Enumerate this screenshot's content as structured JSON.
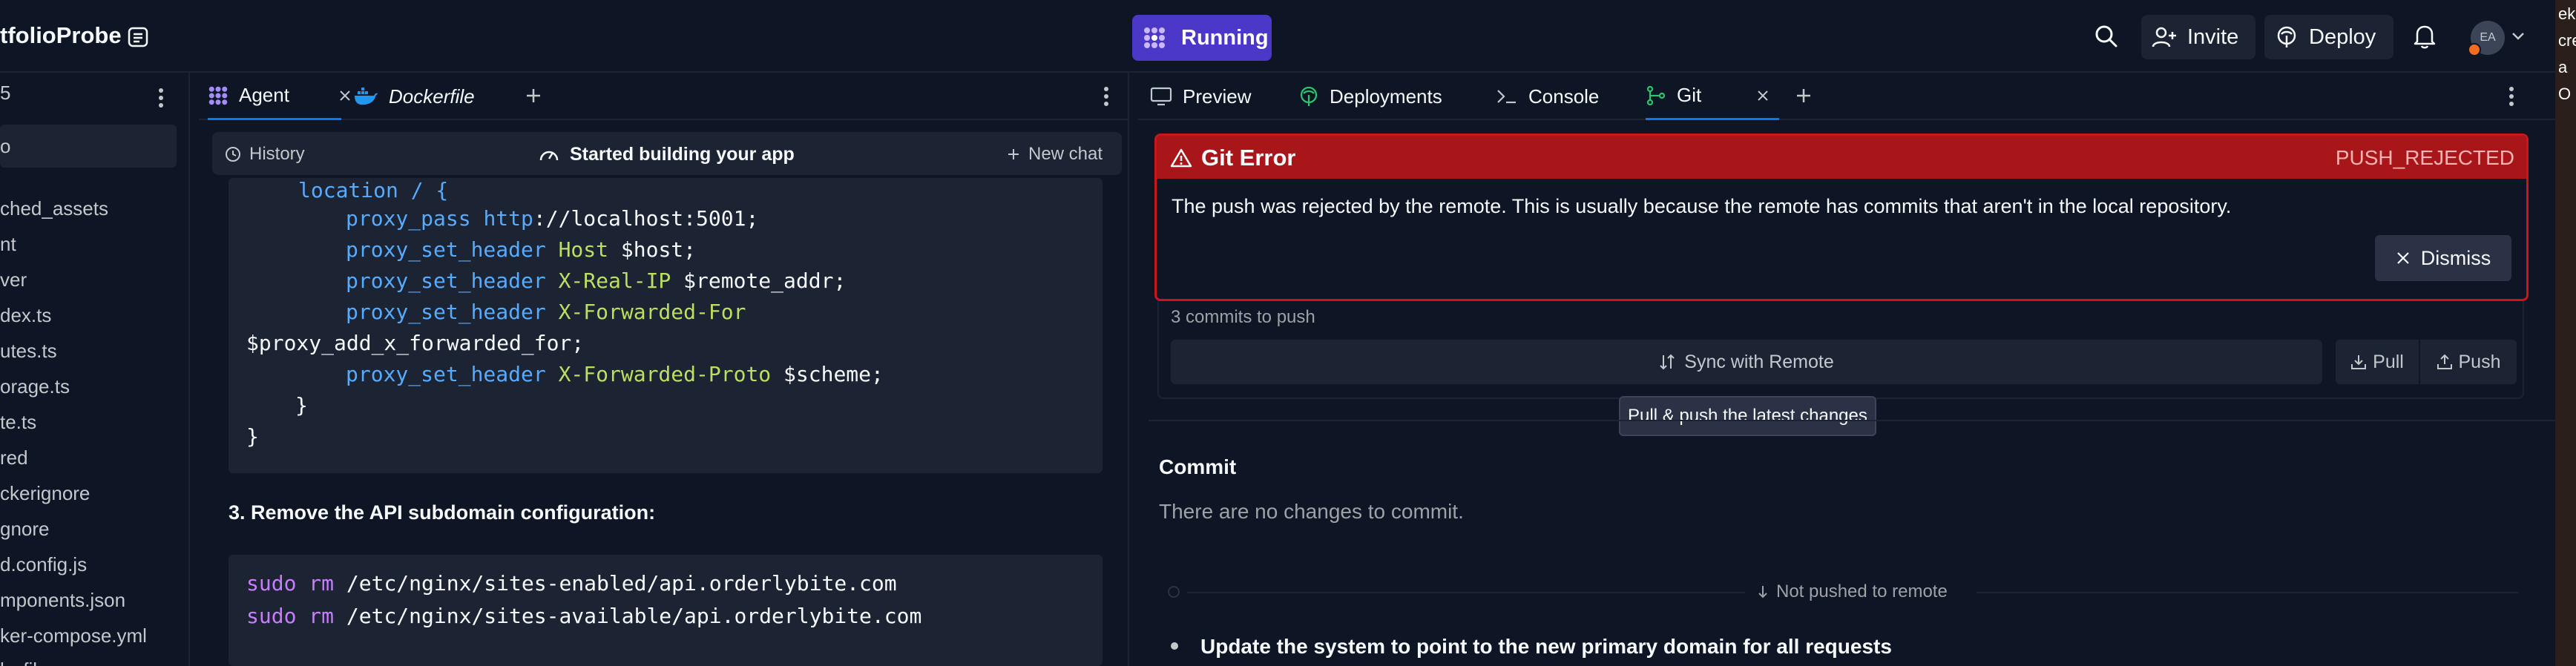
{
  "topbar": {
    "app_name": "tfolioProbe",
    "run_label": "Running",
    "invite_label": "Invite",
    "deploy_label": "Deploy",
    "avatar_initials": "EA"
  },
  "right_strip": {
    "chars": [
      "ek",
      "cre",
      "a",
      "O"
    ]
  },
  "filetree": {
    "header": "5",
    "search_text": "o",
    "items": [
      "ched_assets",
      "nt",
      "ver",
      "dex.ts",
      "utes.ts",
      "orage.ts",
      "te.ts",
      "red",
      "ckerignore",
      "gnore",
      "d.config.js",
      "mponents.json",
      "ker-compose.yml",
      "ky.fil"
    ]
  },
  "agent": {
    "tabs": [
      {
        "label": "Agent"
      },
      {
        "label": "Dockerfile"
      }
    ],
    "toolbar": {
      "history_label": "History",
      "title": "Started building your app",
      "new_chat_label": "New chat"
    },
    "code1": {
      "line0": "location / {",
      "lines": [
        {
          "kw": "proxy_pass",
          "fn": "",
          "rest1": " ",
          "kwrest": "http",
          "rest2": "://localhost:5001;"
        },
        {
          "kw": "proxy_set_header",
          "fn": " Host",
          "rest1": " $host;"
        },
        {
          "kw": "proxy_set_header",
          "fn": " X-Real-IP",
          "rest1": " $remote_addr;"
        },
        {
          "kw": "proxy_set_header",
          "fn": " X-Forwarded-For",
          "rest1": ""
        },
        {
          "kw": "",
          "fn": "",
          "rest1": "$proxy_add_x_forwarded_for;"
        },
        {
          "kw": "proxy_set_header",
          "fn": " X-Forwarded-Proto",
          "rest1": " $scheme;"
        }
      ],
      "close_inner": "}",
      "close_outer": "}"
    },
    "step3_heading": "3. Remove the API subdomain configuration:",
    "code2": {
      "line1_cmd": "sudo",
      "line1_kw": " rm",
      "line1_path": " /etc/nginx/sites-enabled/api.orderlybite.com",
      "line2_cmd": "sudo",
      "line2_kw": " rm",
      "line2_path": " /etc/nginx/sites-available/api.orderlybite.com"
    }
  },
  "git_panel": {
    "tabs": [
      {
        "label": "Preview"
      },
      {
        "label": "Deployments"
      },
      {
        "label": "Console"
      },
      {
        "label": "Git"
      }
    ],
    "error": {
      "title": "Git Error",
      "code": "PUSH_REJECTED",
      "message": "The push was rejected by the remote. This is usually because the remote has commits that aren't in the local repository.",
      "dismiss_label": "Dismiss"
    },
    "commits_to_push": "3 commits to push",
    "sync_label": "Sync with Remote",
    "pull_label": "Pull",
    "push_label": "Push",
    "tooltip": "Pull & push the latest changes",
    "commit_heading": "Commit",
    "no_changes": "There are no changes to commit.",
    "not_pushed_label": "Not pushed to remote",
    "commit_item": "Update the system to point to the new primary domain for all requests"
  },
  "colors": {
    "background": "#0e1525",
    "surface": "#1c2333",
    "accent_run": "#4b37c8",
    "error_red": "#a8161a",
    "active_tab": "#0079f2"
  }
}
